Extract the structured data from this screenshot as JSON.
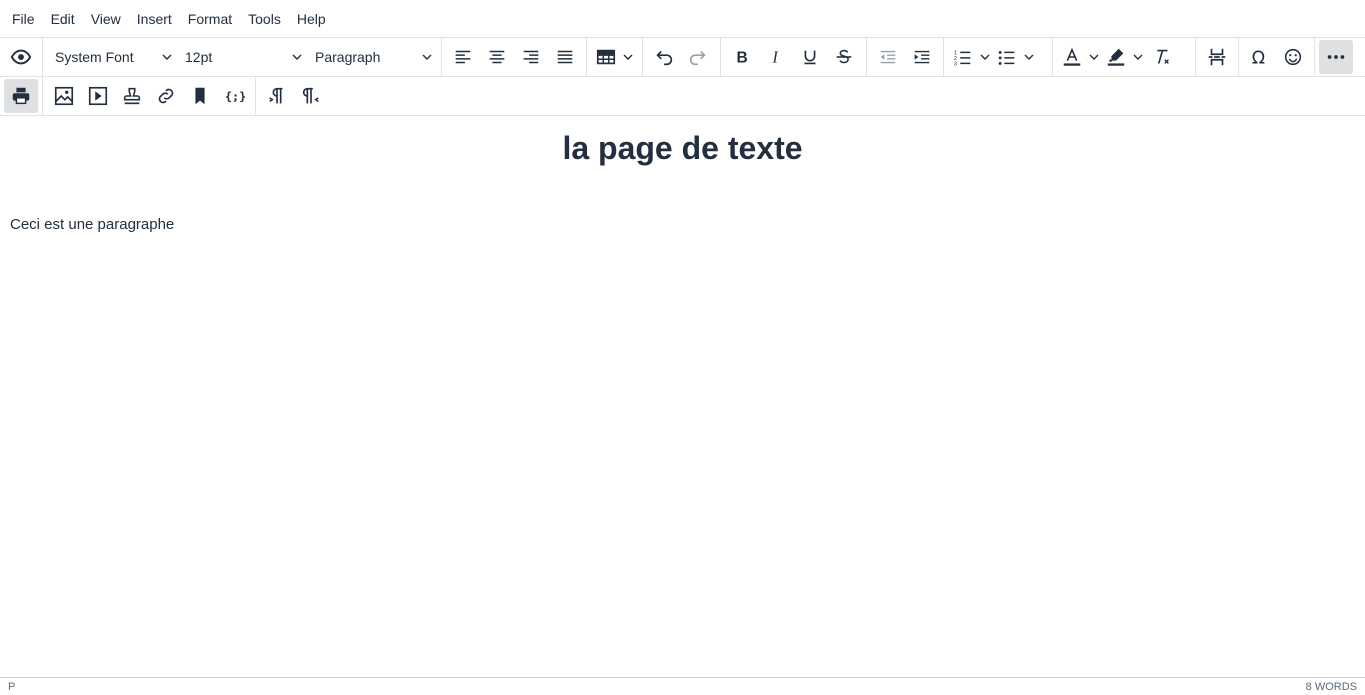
{
  "menubar": {
    "items": [
      "File",
      "Edit",
      "View",
      "Insert",
      "Format",
      "Tools",
      "Help"
    ]
  },
  "toolbar": {
    "font_family": "System Font",
    "font_size": "12pt",
    "block_format": "Paragraph"
  },
  "document": {
    "title": "la page de texte",
    "paragraph": "Ceci est une paragraphe"
  },
  "statusbar": {
    "path": "P",
    "word_count": "8 WORDS"
  }
}
